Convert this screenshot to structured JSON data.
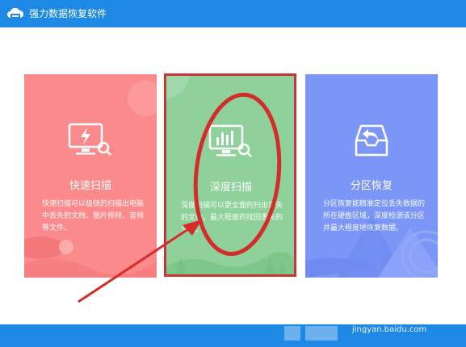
{
  "window": {
    "title": "强力数据恢复软件",
    "icon": "cloud-drive-icon"
  },
  "cards": [
    {
      "label": "快速扫描",
      "description": "快速扫描可以极快的扫描出电脑中丢失的文档、图片视频、音频等文件。",
      "icon": "monitor-flash-search-icon",
      "color": "#fb8a8c"
    },
    {
      "label": "深度扫描",
      "description": "深度扫描可以更全面的扫出丢失的文件，最大程度的找回丢失的文件。",
      "icon": "monitor-chart-search-icon",
      "color": "#8fd19a"
    },
    {
      "label": "分区恢复",
      "description": "分区恢复能精准定位丢失数据的所在硬盘区域，深度检测该分区并最大程度地恢复数据。",
      "icon": "tray-restore-icon",
      "color": "#7c96f7"
    }
  ],
  "annotation": {
    "color": "#d42b2b"
  },
  "watermark": {
    "logo": "Bai 经验",
    "url": "jingyan.baidu.com"
  },
  "colors": {
    "titlebar": "#1e88e5"
  }
}
